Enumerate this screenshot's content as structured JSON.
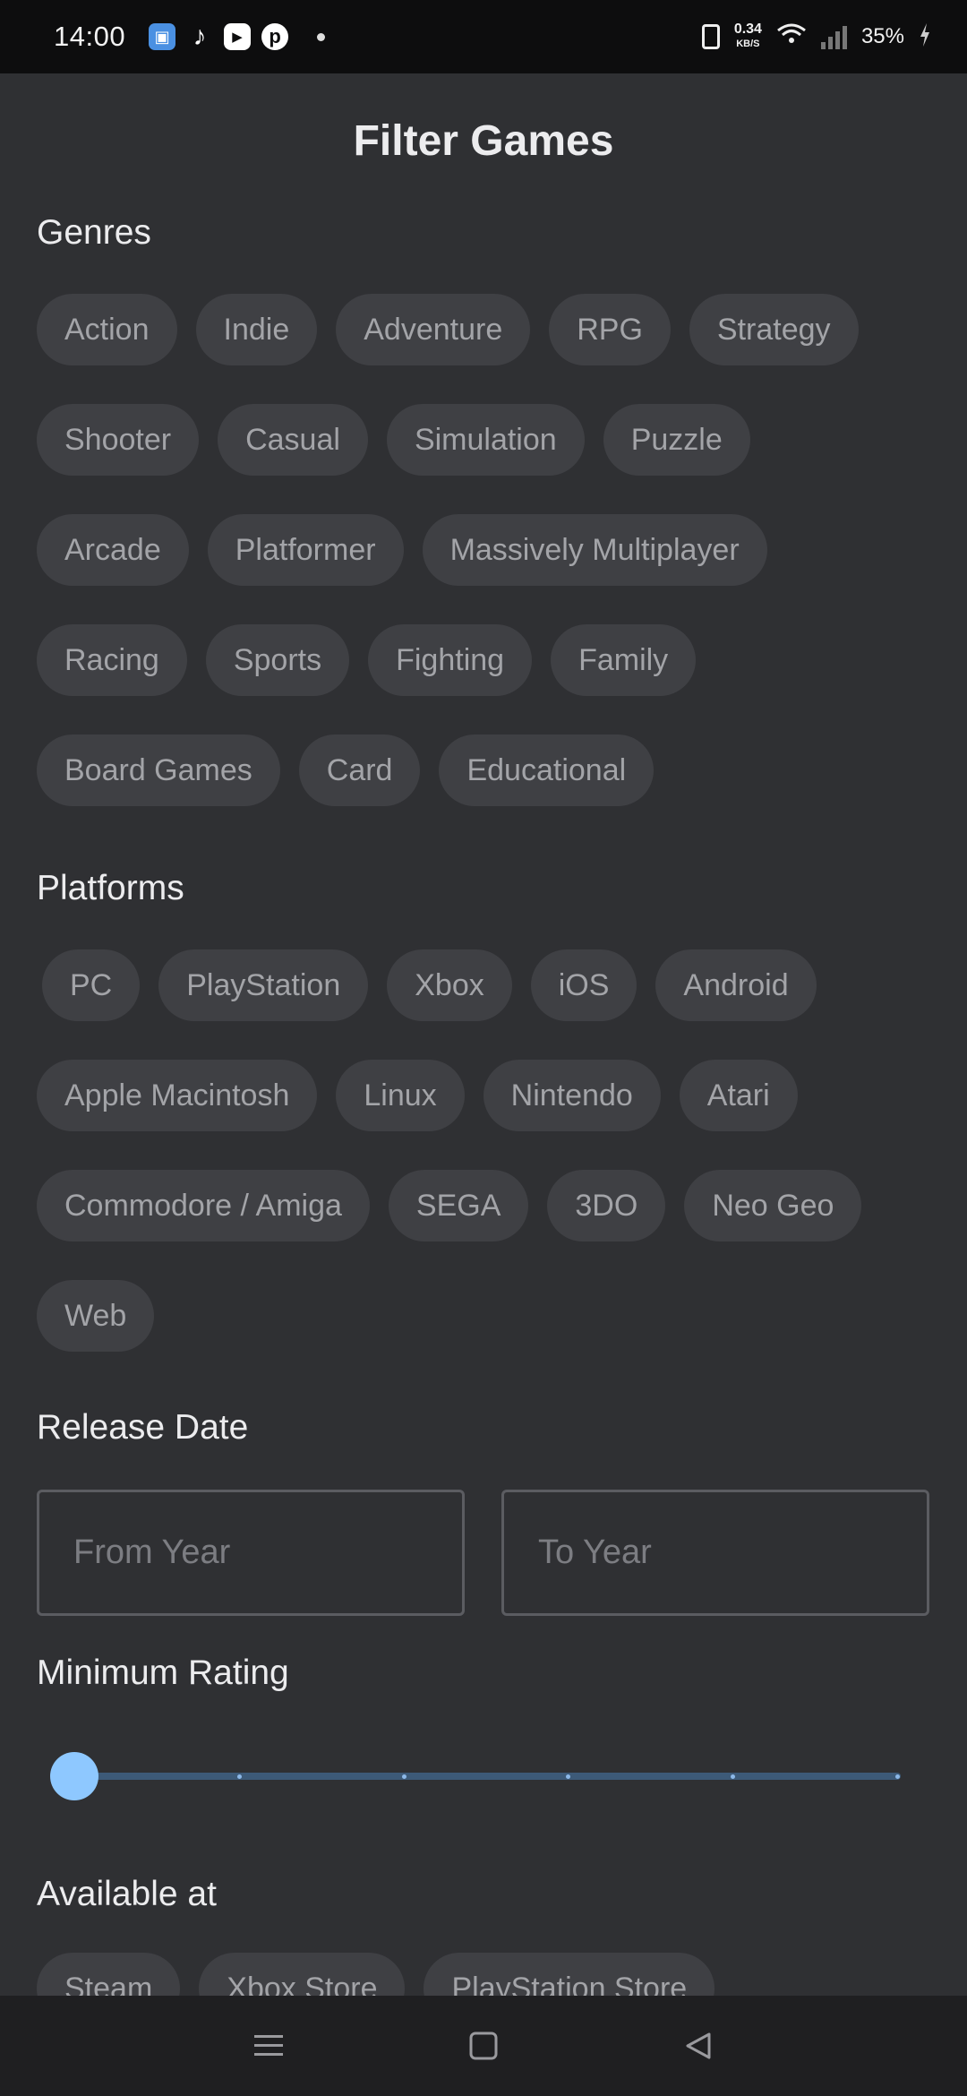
{
  "status_bar": {
    "time": "14:00",
    "net_speed_value": "0.34",
    "net_speed_unit": "KB/S",
    "battery": "35%",
    "icons": [
      "app-icon",
      "tiktok-icon",
      "youtube-icon",
      "pinterest-icon",
      "vibrate-icon",
      "wifi-icon",
      "signal-icon",
      "battery-charging-icon"
    ]
  },
  "title": "Filter Games",
  "genres": {
    "label": "Genres",
    "rows": [
      [
        "Action",
        "Indie",
        "Adventure",
        "RPG",
        "Strategy"
      ],
      [
        "Shooter",
        "Casual",
        "Simulation",
        "Puzzle"
      ],
      [
        "Arcade",
        "Platformer",
        "Massively Multiplayer"
      ],
      [
        "Racing",
        "Sports",
        "Fighting",
        "Family"
      ],
      [
        "Board Games",
        "Card",
        "Educational"
      ]
    ]
  },
  "platforms": {
    "label": "Platforms",
    "rows": [
      [
        "PC",
        "PlayStation",
        "Xbox",
        "iOS",
        "Android"
      ],
      [
        "Apple Macintosh",
        "Linux",
        "Nintendo",
        "Atari"
      ],
      [
        "Commodore / Amiga",
        "SEGA",
        "3DO",
        "Neo Geo"
      ],
      [
        "Web"
      ]
    ]
  },
  "release_date": {
    "label": "Release Date",
    "from_placeholder": "From Year",
    "to_placeholder": "To Year"
  },
  "rating": {
    "label": "Minimum Rating",
    "value": 0,
    "steps": 5
  },
  "stores": {
    "label": "Available at",
    "items": [
      "Steam",
      "Xbox Store",
      "PlayStation Store"
    ]
  },
  "colors": {
    "background": "#2f3033",
    "chip_bg": "#3f4044",
    "chip_text": "#a3a4a8",
    "accent": "#8ec8ff"
  }
}
